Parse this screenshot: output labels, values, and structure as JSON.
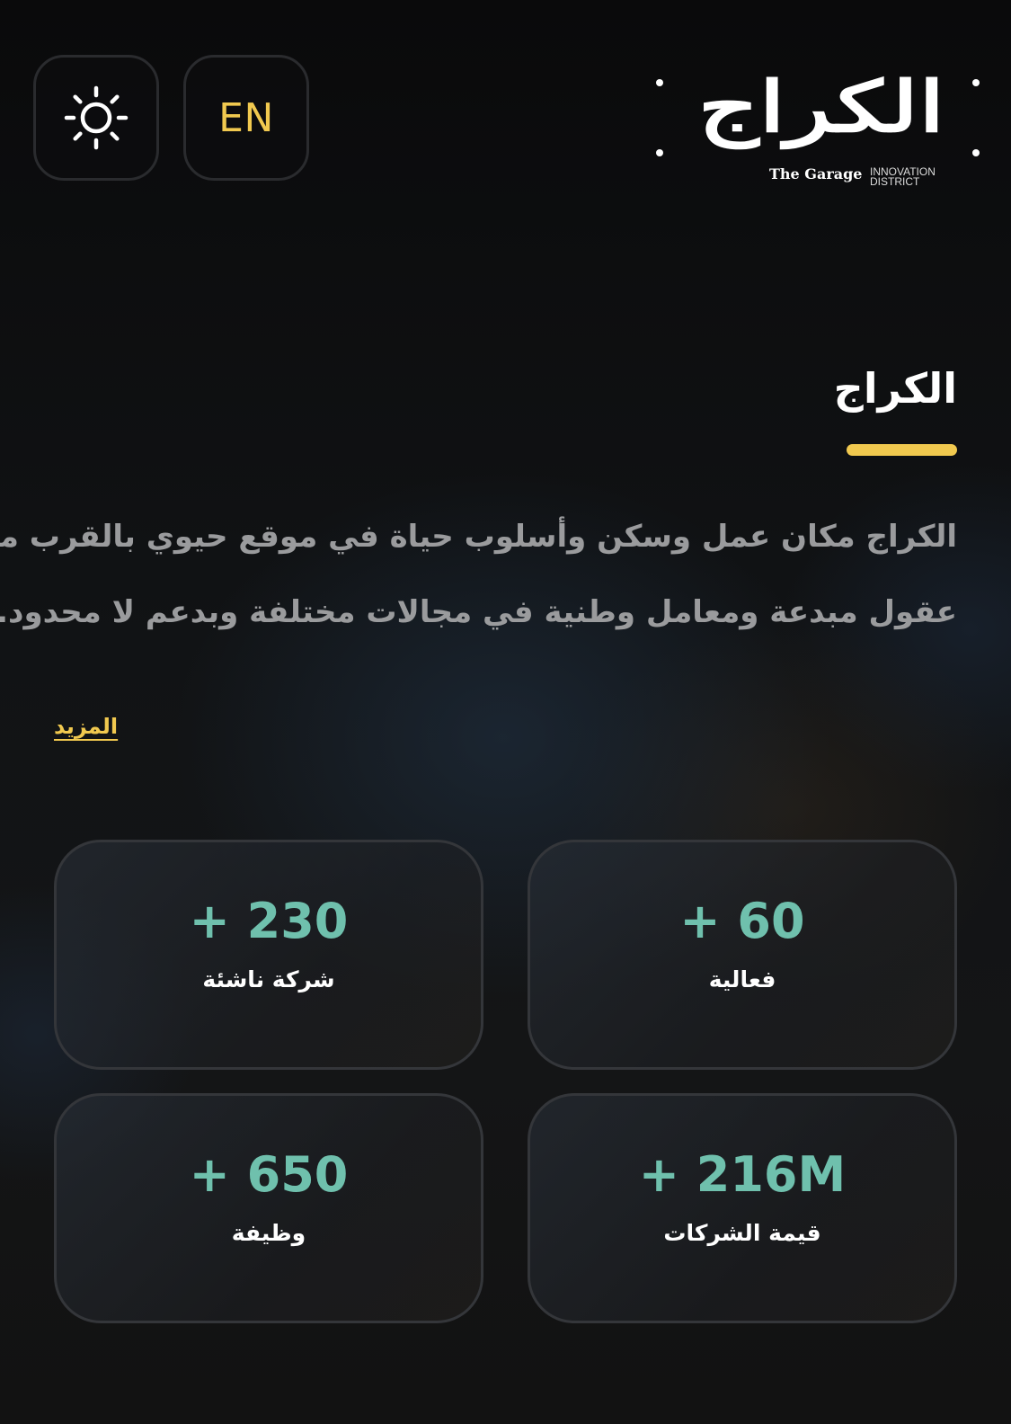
{
  "header": {
    "theme_icon": "sun-icon",
    "language_toggle": "EN",
    "logo": {
      "arabic": "الكراج",
      "english": "The Garage",
      "tagline": "INNOVATION DISTRICT"
    }
  },
  "about": {
    "title": "الكراج",
    "description_lines": [
      "الكراج مكان عمل وسكن وأسلوب حياة في موقع حيوي بالقرب من",
      "عقول مبدعة ومعامل وطنية في مجالات مختلفة وبدعم  لا محدود..."
    ],
    "more_link": "المزيد"
  },
  "stats": [
    {
      "value": "+ 60",
      "label": "فعالية"
    },
    {
      "value": "+ 230",
      "label": "شركة ناشئة"
    },
    {
      "value": "+ 216M",
      "label": "قيمة الشركات"
    },
    {
      "value": "+ 650",
      "label": "وظيفة"
    }
  ],
  "colors": {
    "accent_yellow": "#f1c94f",
    "stat_teal": "#6fc0ad",
    "background": "#0d0d0e"
  }
}
